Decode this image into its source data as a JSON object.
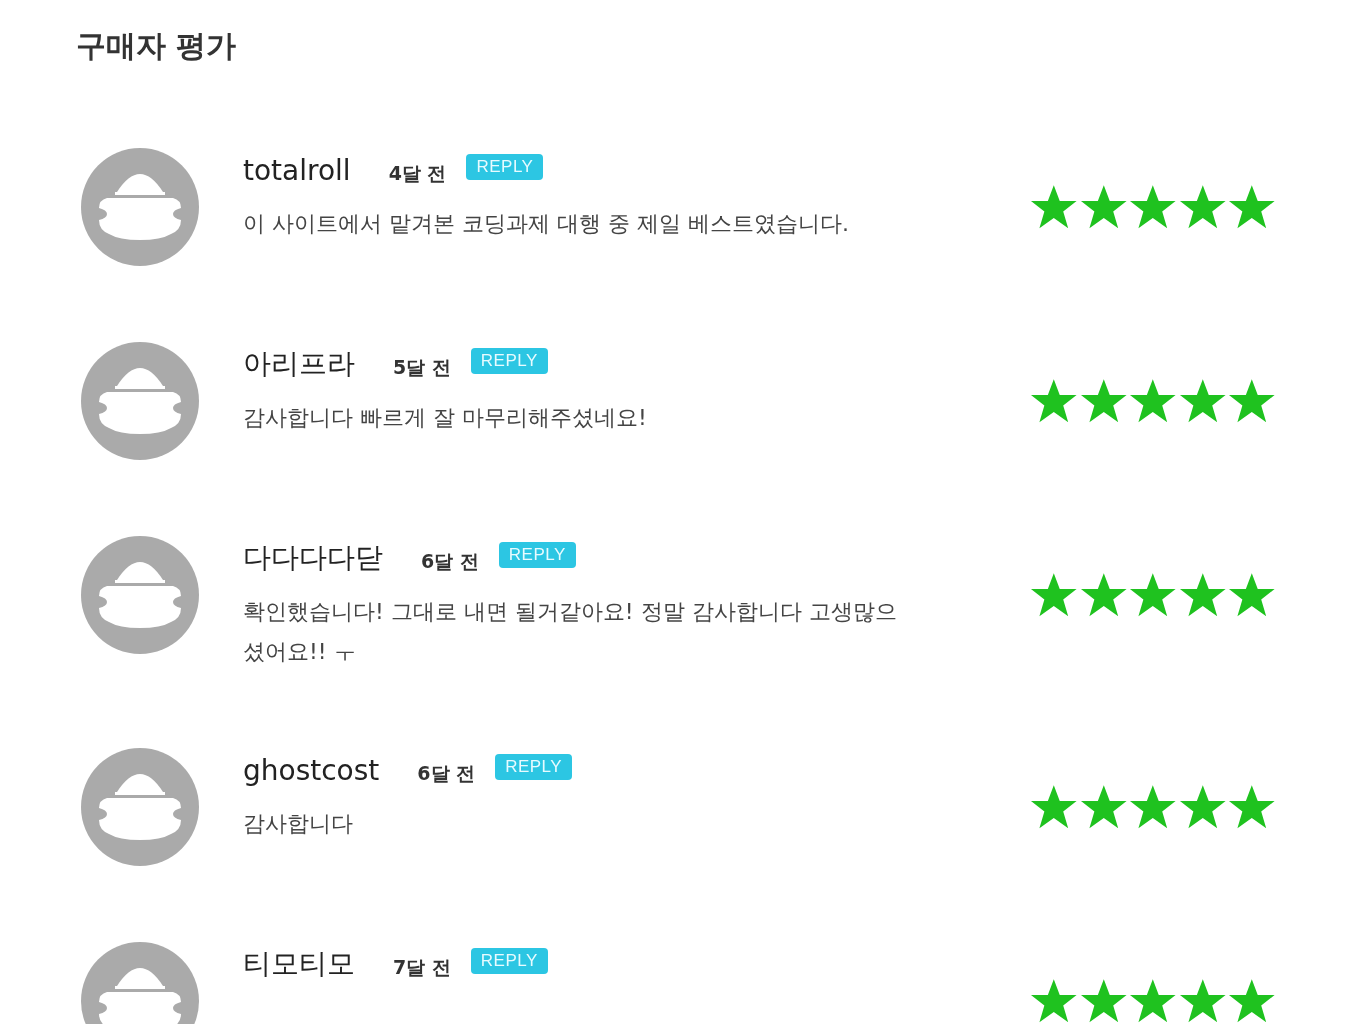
{
  "section_title": "구매자 평가",
  "reviews": [
    {
      "name": "totalroll",
      "time": "4달 전",
      "reply": "REPLY",
      "comment": "이 사이트에서 맡겨본 코딩과제 대행 중 제일 베스트였습니다.",
      "stars": 5
    },
    {
      "name": "아리프라",
      "time": "5달 전",
      "reply": "REPLY",
      "comment": "감사합니다 빠르게 잘 마무리해주셨네요!",
      "stars": 5
    },
    {
      "name": "다다다다닫",
      "time": "6달 전",
      "reply": "REPLY",
      "comment": "확인했습니다! 그대로 내면 될거같아요! 정말 감사합니다 고생많으셨어요!! ㅜ",
      "stars": 5
    },
    {
      "name": "ghostcost",
      "time": "6달 전",
      "reply": "REPLY",
      "comment": "감사합니다",
      "stars": 5
    },
    {
      "name": "티모티모",
      "time": "7달 전",
      "reply": "REPLY",
      "stars": 5
    }
  ]
}
